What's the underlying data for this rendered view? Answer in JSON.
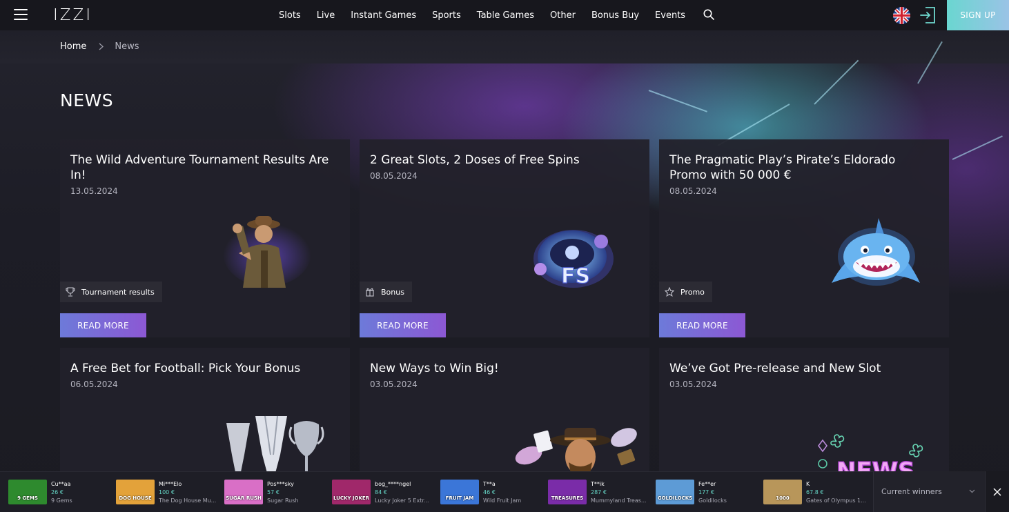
{
  "header": {
    "logo": "IZZI",
    "nav": [
      "Slots",
      "Live",
      "Instant Games",
      "Sports",
      "Table Games",
      "Other",
      "Bonus Buy",
      "Events"
    ],
    "signup_label": "SIGN UP"
  },
  "breadcrumb": {
    "home": "Home",
    "current": "News"
  },
  "page_title": "NEWS",
  "cards": [
    {
      "title": "The Wild Adventure Tournament Results Are In!",
      "date": "13.05.2024",
      "tag": "Tournament results",
      "tag_icon": "trophy-icon",
      "button": "READ MORE"
    },
    {
      "title": "2 Great Slots, 2 Doses of Free Spins",
      "date": "08.05.2024",
      "tag": "Bonus",
      "tag_icon": "gift-icon",
      "button": "READ MORE"
    },
    {
      "title": "The Pragmatic Play’s Pirate’s Eldorado Promo with 50 000 €",
      "date": "08.05.2024",
      "tag": "Promo",
      "tag_icon": "star-icon",
      "button": "READ MORE"
    },
    {
      "title": "A Free Bet for Football: Pick Your Bonus",
      "date": "06.05.2024"
    },
    {
      "title": "New Ways to Win Big!",
      "date": "03.05.2024"
    },
    {
      "title": "We’ve Got Pre-release and New Slot",
      "date": "03.05.2024"
    }
  ],
  "card_art_text": {
    "fs": "FS",
    "news": "NEWS"
  },
  "winners": [
    {
      "user": "Cu**aa",
      "amount": "26 €",
      "game": "9 Gems",
      "thumb_color": "#2e8a2e"
    },
    {
      "user": "Mi***Elo",
      "amount": "100 €",
      "game": "The Dog House Mu...",
      "thumb_color": "#e3a23a"
    },
    {
      "user": "Pos***sky",
      "amount": "57 €",
      "game": "Sugar Rush",
      "thumb_color": "#d96fc6"
    },
    {
      "user": "bog_****ngel",
      "amount": "84 €",
      "game": "Lucky Joker 5 Extr...",
      "thumb_color": "#a0286a"
    },
    {
      "user": "T**a",
      "amount": "46 €",
      "game": "Wild Fruit Jam",
      "thumb_color": "#3b76d8"
    },
    {
      "user": "T**ik",
      "amount": "287 €",
      "game": "Mummyland Treas...",
      "thumb_color": "#7a2ca8"
    },
    {
      "user": "Fe**er",
      "amount": "177 €",
      "game": "Goldilocks",
      "thumb_color": "#5d9bd6"
    },
    {
      "user": "K",
      "amount": "67.8 €",
      "game": "Gates of Olympus 1...",
      "thumb_color": "#b8965a"
    }
  ],
  "winners_thumb_labels": [
    "9 GEMS",
    "DOG HOUSE",
    "SUGAR RUSH",
    "LUCKY JOKER",
    "FRUIT JAM",
    "TREASURES",
    "GOLDILOCKS",
    "1000"
  ],
  "current_winners_label": "Current winners",
  "colors": {
    "accent_start": "#6d7ad9",
    "accent_end": "#8c58d4",
    "signup_start": "#6ad6d0",
    "amount": "#66d7c7"
  }
}
